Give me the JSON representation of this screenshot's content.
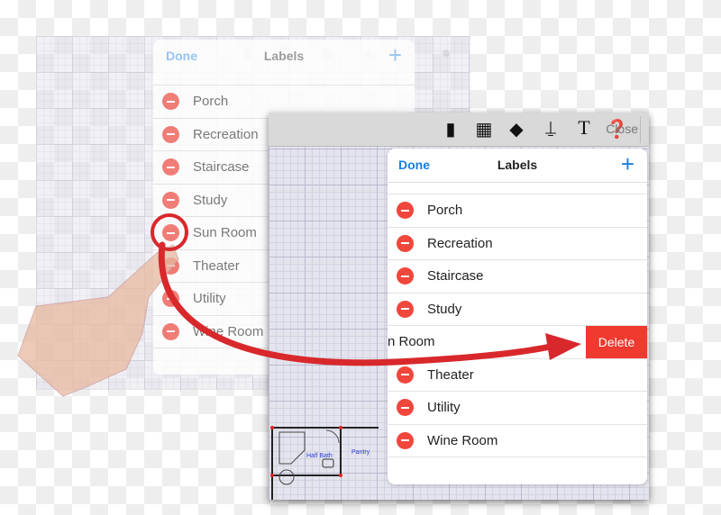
{
  "back_panel": {
    "header": {
      "done": "Done",
      "title": "Labels",
      "plus": "+"
    },
    "rows": [
      "Porch",
      "Recreation",
      "Staircase",
      "Study",
      "Sun Room",
      "Theater",
      "Utility",
      "Wine Room"
    ]
  },
  "front_panel": {
    "toolbar": {
      "icons": [
        "page-number-icon",
        "calculator-icon",
        "tag-icon",
        "stamp-icon",
        "text-icon",
        "help-icon"
      ],
      "close": "Close"
    },
    "header": {
      "done": "Done",
      "title": "Labels",
      "plus": "+"
    },
    "rows": [
      "Porch",
      "Recreation",
      "Staircase",
      "Study",
      "Sun Room",
      "Theater",
      "Utility",
      "Wine Room"
    ],
    "delete_label": "Delete",
    "plan_labels": {
      "half_bath": "Half Bath",
      "pantry": "Pantry"
    }
  },
  "colors": {
    "accent": "#1a7ee0",
    "delete": "#f0392f",
    "arrow": "#d8282c"
  }
}
